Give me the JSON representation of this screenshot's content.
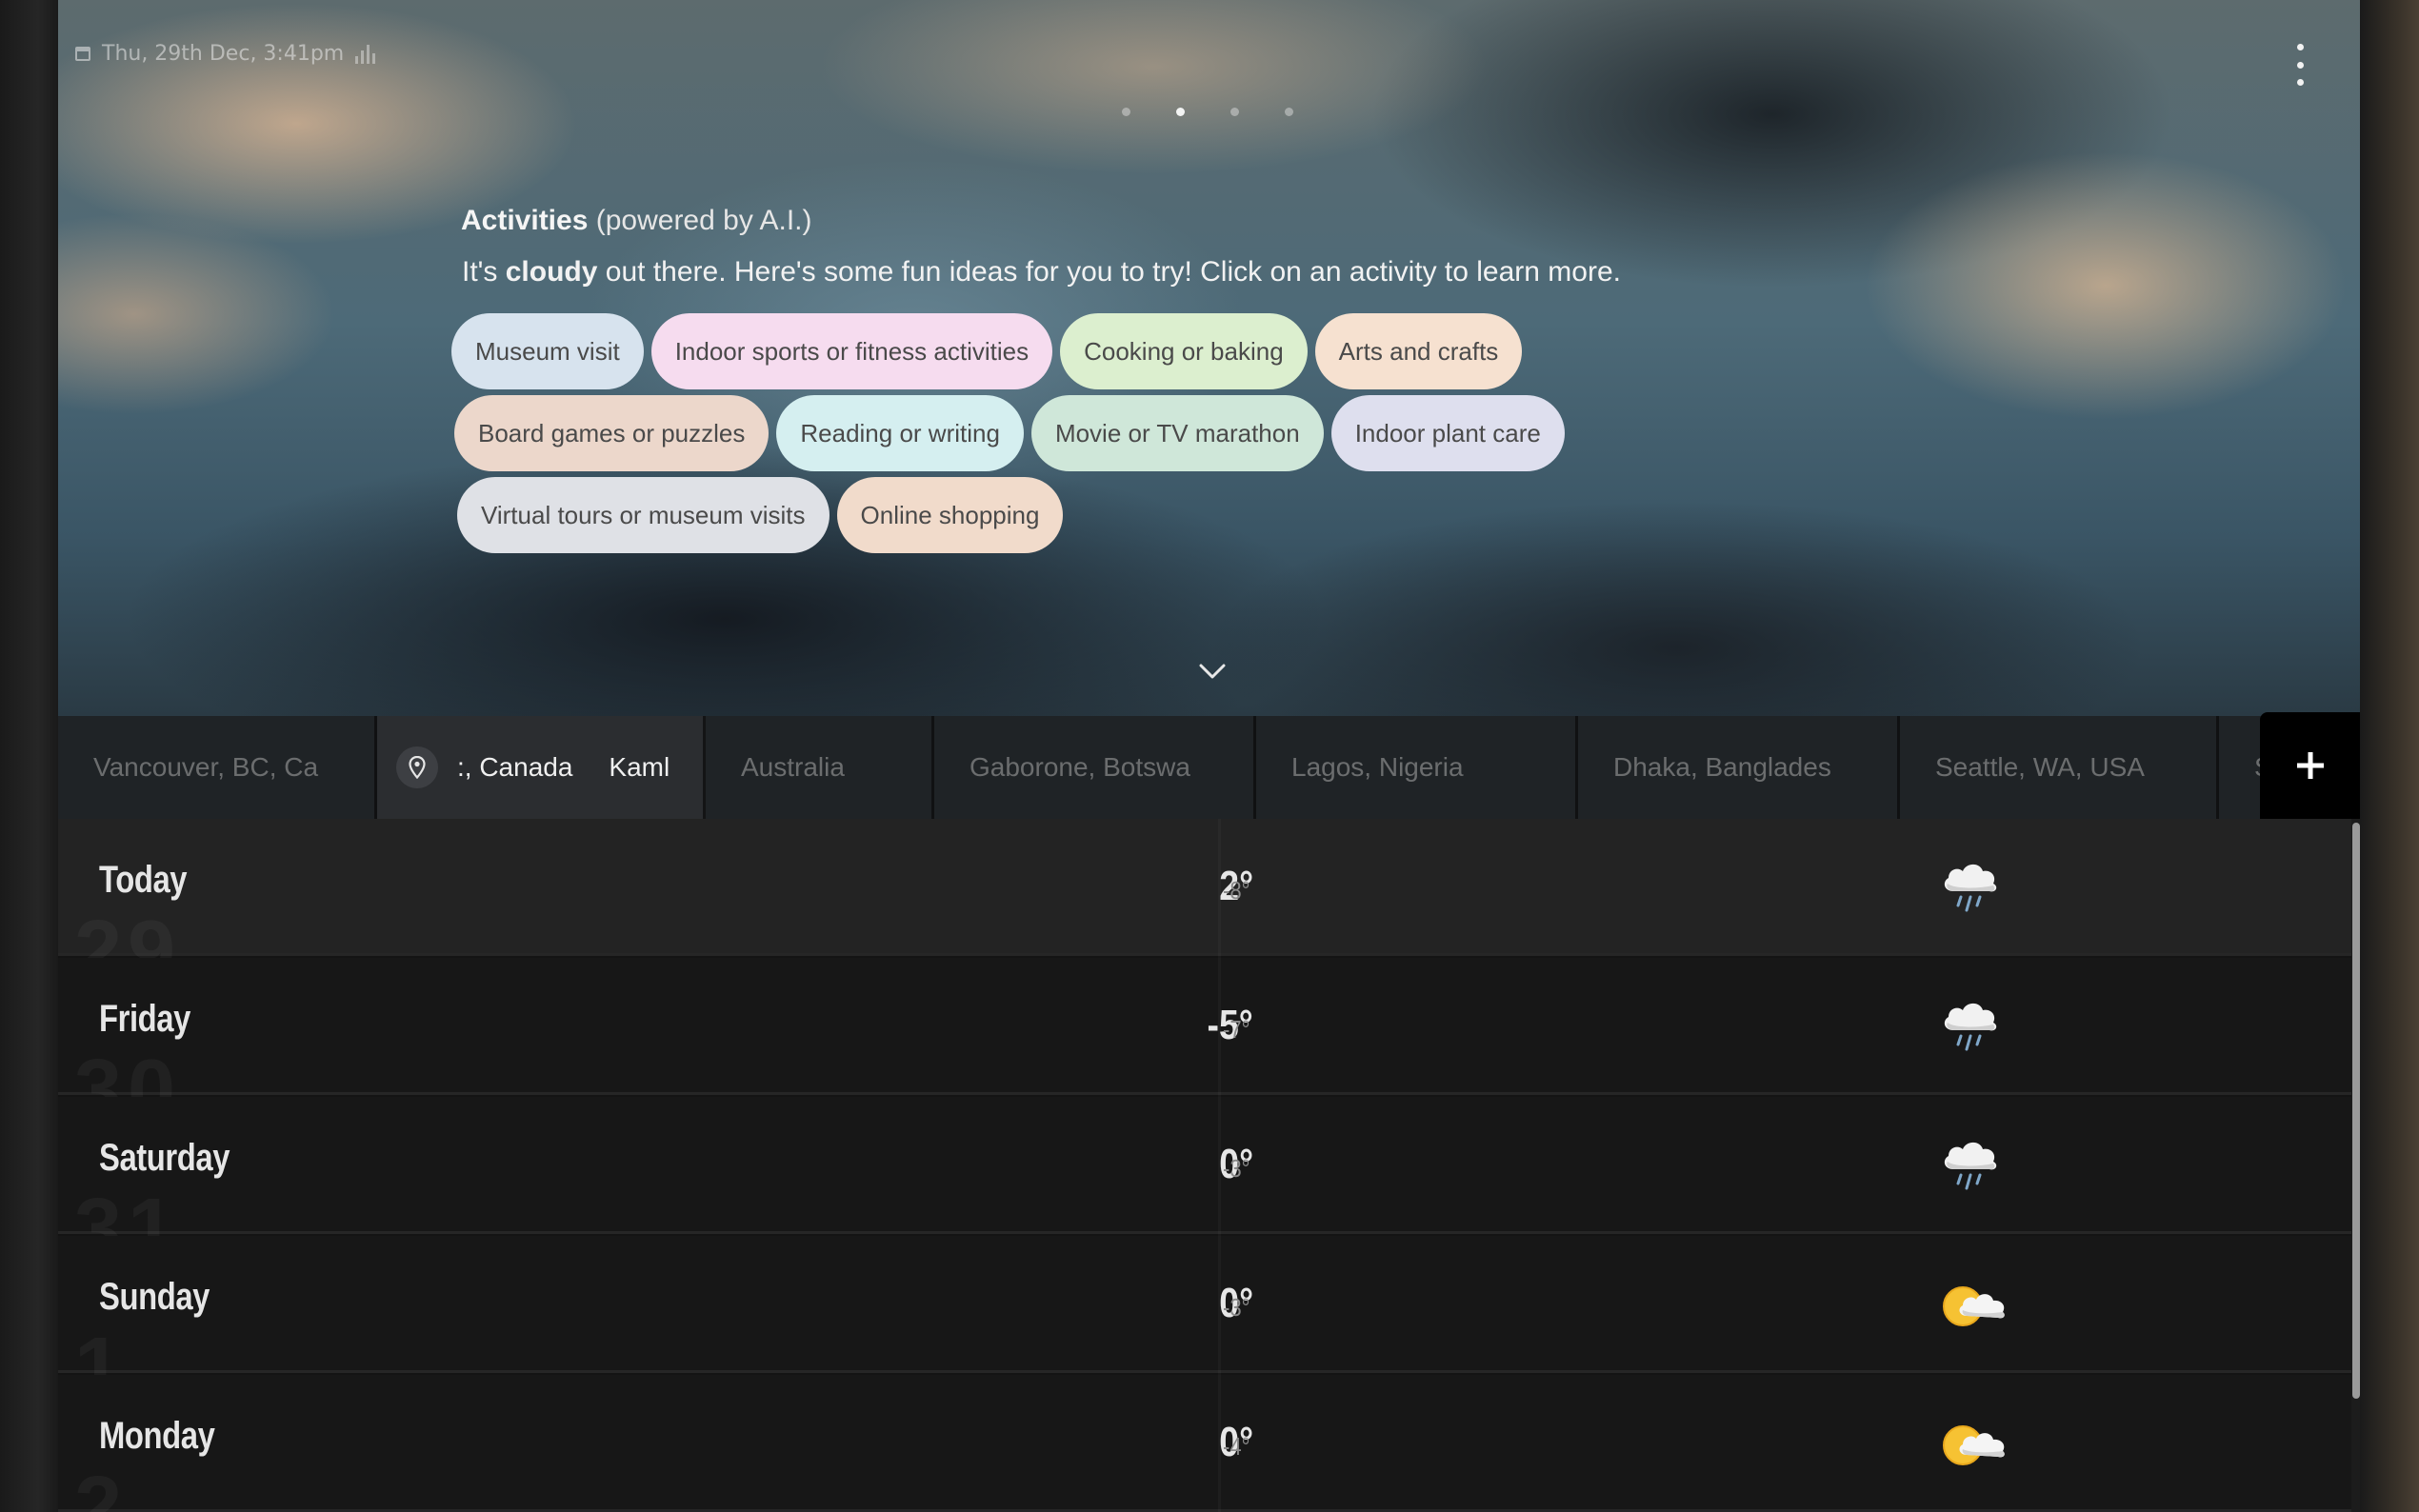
{
  "status": {
    "datetime": "Thu, 29th Dec, 3:41pm"
  },
  "pager": {
    "pages": 4,
    "active_index": 1
  },
  "activities": {
    "title_bold": "Activities",
    "title_rest": "(powered by A.I.)",
    "subtitle_pre": "It's",
    "subtitle_bold": "cloudy",
    "subtitle_post": "out there. Here's some fun ideas for you to try! Click on an activity to learn more.",
    "rows": [
      [
        {
          "label": "Museum visit",
          "color": "#d7e3ee"
        },
        {
          "label": "Indoor sports or fitness activities",
          "color": "#f6dcef"
        },
        {
          "label": "Cooking or baking",
          "color": "#dcefcf"
        },
        {
          "label": "Arts and crafts",
          "color": "#f6e1d0"
        }
      ],
      [
        {
          "label": "Board games or puzzles",
          "color": "#ecd7cb"
        },
        {
          "label": "Reading or writing",
          "color": "#d5eff0"
        },
        {
          "label": "Movie or TV marathon",
          "color": "#cfe7d9"
        },
        {
          "label": "Indoor plant care",
          "color": "#dedfee"
        }
      ],
      [
        {
          "label": "Virtual tours or museum visits",
          "color": "#dfe1e6"
        },
        {
          "label": "Online shopping",
          "color": "#f1dbcb"
        }
      ]
    ]
  },
  "locations": [
    {
      "label": "Vancouver, BC, Ca",
      "active": false
    },
    {
      "label": ":, Canada",
      "label2": "Kaml",
      "active": true
    },
    {
      "label": "Australia",
      "active": false
    },
    {
      "label": "Gaborone, Botswa",
      "active": false
    },
    {
      "label": "Lagos, Nigeria",
      "active": false
    },
    {
      "label": "Dhaka, Banglades",
      "active": false
    },
    {
      "label": "Seattle, WA, USA",
      "active": false
    },
    {
      "label": "S",
      "active": false
    }
  ],
  "add_location": {
    "label": "+"
  },
  "forecast": [
    {
      "day": "Today",
      "high": "2°",
      "low": "-8°",
      "icon": "rain-cloud-icon",
      "ghost": "29"
    },
    {
      "day": "Friday",
      "high": "-5°",
      "low": "-7°",
      "icon": "rain-cloud-icon",
      "ghost": "30"
    },
    {
      "day": "Saturday",
      "high": "0°",
      "low": "-3°",
      "icon": "rain-cloud-icon",
      "ghost": "31"
    },
    {
      "day": "Sunday",
      "high": "0°",
      "low": "-3°",
      "icon": "sun-behind-cloud-icon",
      "ghost": "1"
    },
    {
      "day": "Monday",
      "high": "0°",
      "low": "-4°",
      "icon": "sun-behind-cloud-icon",
      "ghost": "2"
    }
  ]
}
